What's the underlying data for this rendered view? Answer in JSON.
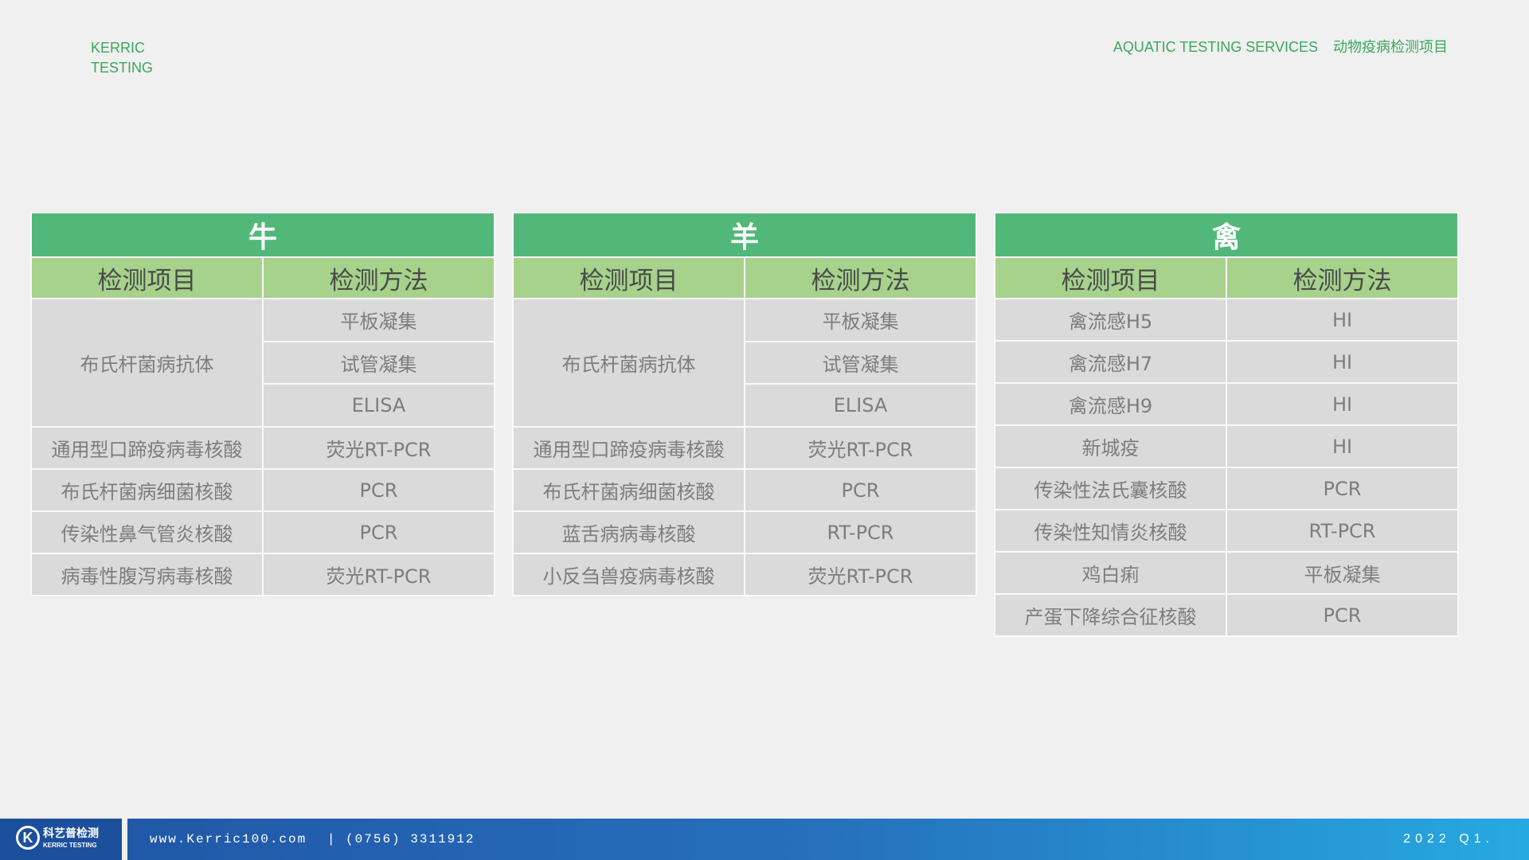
{
  "header": {
    "brand_line1": "KERRIC",
    "brand_line2": "TESTING",
    "services_en": "AQUATIC TESTING SERVICES",
    "services_cn": "动物疫病检测项目"
  },
  "tables": [
    {
      "title": "牛",
      "col_item": "检测项目",
      "col_method": "检测方法",
      "merged_item": "布氏杆菌病抗体",
      "merged_methods": [
        "平板凝集",
        "试管凝集",
        "ELISA"
      ],
      "rows": [
        {
          "item": "通用型口蹄疫病毒核酸",
          "method": "荧光RT-PCR"
        },
        {
          "item": "布氏杆菌病细菌核酸",
          "method": "PCR"
        },
        {
          "item": "传染性鼻气管炎核酸",
          "method": "PCR"
        },
        {
          "item": "病毒性腹泻病毒核酸",
          "method": "荧光RT-PCR"
        }
      ]
    },
    {
      "title": "羊",
      "col_item": "检测项目",
      "col_method": "检测方法",
      "merged_item": "布氏杆菌病抗体",
      "merged_methods": [
        "平板凝集",
        "试管凝集",
        "ELISA"
      ],
      "rows": [
        {
          "item": "通用型口蹄疫病毒核酸",
          "method": "荧光RT-PCR"
        },
        {
          "item": "布氏杆菌病细菌核酸",
          "method": "PCR"
        },
        {
          "item": "蓝舌病病毒核酸",
          "method": "RT-PCR"
        },
        {
          "item": "小反刍兽疫病毒核酸",
          "method": "荧光RT-PCR"
        }
      ]
    },
    {
      "title": "禽",
      "col_item": "检测项目",
      "col_method": "检测方法",
      "rows": [
        {
          "item": "禽流感H5",
          "method": "HI"
        },
        {
          "item": "禽流感H7",
          "method": "HI"
        },
        {
          "item": "禽流感H9",
          "method": "HI"
        },
        {
          "item": "新城疫",
          "method": "HI"
        },
        {
          "item": "传染性法氏囊核酸",
          "method": "PCR"
        },
        {
          "item": "传染性知情炎核酸",
          "method": "RT-PCR"
        },
        {
          "item": "鸡白痢",
          "method": "平板凝集"
        },
        {
          "item": "产蛋下降综合征核酸",
          "method": "PCR"
        }
      ]
    }
  ],
  "footer": {
    "logo_cn": "科艺普检测",
    "logo_en": "KERRIC TESTING",
    "website": "www.Kerric100.com",
    "phone": "| (0756) 3311912",
    "date": "2022 Q1."
  }
}
